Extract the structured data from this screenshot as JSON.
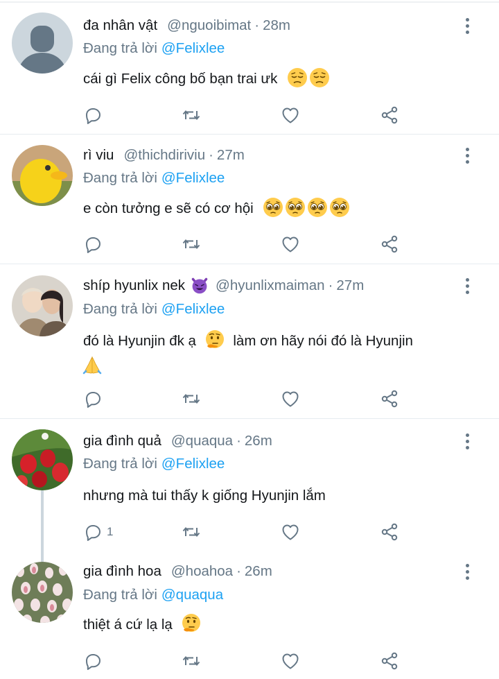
{
  "reply_prefix": "Đang trả lời",
  "colors": {
    "accent": "#1da1f2",
    "muted": "#657786",
    "text": "#14171a",
    "divider": "#e6ecf0"
  },
  "tweets": [
    {
      "name": "đa nhân vật",
      "handle": "@nguoibimat",
      "dot": "·",
      "time": "28m",
      "reply_to": "@Felixlee",
      "text": "cái gì Felix công bố bạn trai ưk",
      "text_emojis": [
        "pensive-face",
        "pensive-face"
      ],
      "reply_count": ""
    },
    {
      "name": "rì viu",
      "handle": "@thichdiriviu",
      "dot": "·",
      "time": "27m",
      "reply_to": "@Felixlee",
      "text": "e còn tưởng e sẽ có cơ hội",
      "text_emojis": [
        "pleading-face",
        "pleading-face",
        "pleading-face",
        "pleading-face"
      ],
      "reply_count": ""
    },
    {
      "name": "shíp hyunlix nek",
      "name_emoji": "smiling-face-with-horns",
      "handle": "@hyunlixmaiman",
      "dot": "·",
      "time": "27m",
      "reply_to": "@Felixlee",
      "text_part1": "đó là Hyunjin đk ạ",
      "text_part2": "làm ơn hãy nói đó là Hyunjin",
      "text_emojis": [
        "thinking-face",
        "folded-hands"
      ],
      "reply_count": ""
    },
    {
      "name": "gia đình quả",
      "handle": "@quaqua",
      "dot": "·",
      "time": "26m",
      "reply_to": "@Felixlee",
      "text": "nhưng mà tui thấy k giống Hyunjin lắm",
      "reply_count": "1"
    },
    {
      "name": "gia đình hoa",
      "handle": "@hoahoa",
      "dot": "·",
      "time": "26m",
      "reply_to": "@quaqua",
      "text": "thiệt á cứ lạ lạ",
      "text_emojis": [
        "thinking-face"
      ],
      "reply_count": ""
    }
  ]
}
